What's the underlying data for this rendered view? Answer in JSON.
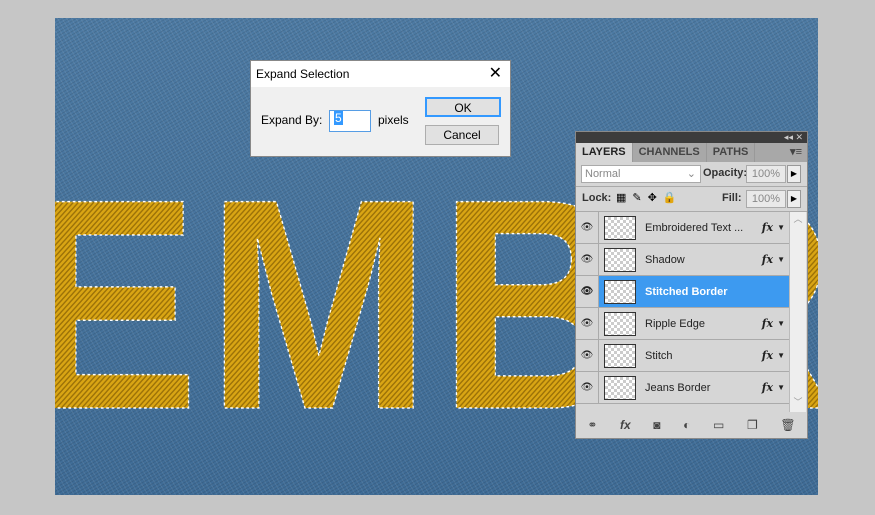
{
  "canvas": {
    "text": "EMBRO"
  },
  "dialog": {
    "title": "Expand Selection",
    "expand_label": "Expand By:",
    "value": "5",
    "unit": "pixels",
    "ok": "OK",
    "cancel": "Cancel"
  },
  "panel": {
    "tabs": [
      "LAYERS",
      "CHANNELS",
      "PATHS"
    ],
    "blend_mode": "Normal",
    "opacity_label": "Opacity:",
    "opacity": "100%",
    "lock_label": "Lock:",
    "fill_label": "Fill:",
    "fill": "100%",
    "layers": [
      {
        "name": "Embroidered Text ...",
        "fx": "fx"
      },
      {
        "name": "Shadow",
        "fx": "fx"
      },
      {
        "name": "Stitched Border",
        "fx": ""
      },
      {
        "name": "Ripple Edge",
        "fx": "fx"
      },
      {
        "name": "Stitch",
        "fx": "fx"
      },
      {
        "name": "Jeans Border",
        "fx": "fx"
      }
    ]
  }
}
